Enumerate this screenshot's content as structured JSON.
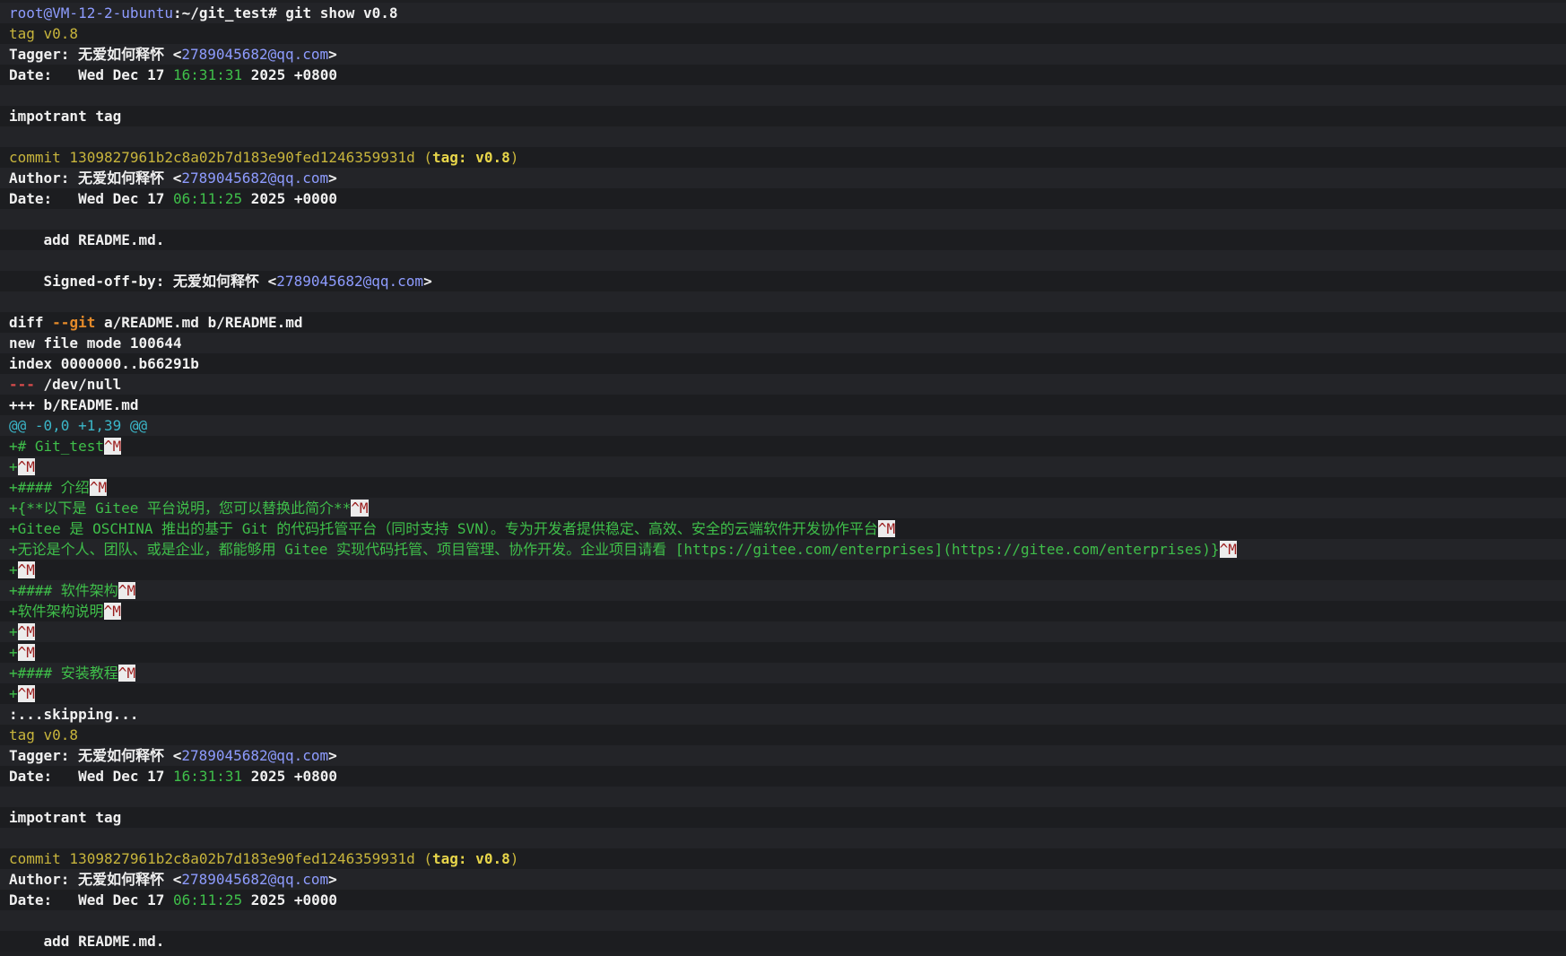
{
  "theme": {
    "background": "#1e1f22",
    "prompt": "#8e9cff",
    "yellow": "#c8b53c",
    "green": "#3fbf4a",
    "cyan": "#3bb7c9",
    "orange": "#e48a2a",
    "red": "#d64b4b",
    "ctrl_char_fg": "#9a1c1c",
    "ctrl_char_bg": "#ececec"
  },
  "lines": [
    [
      {
        "t": "root@VM-12-2-ubuntu",
        "c": "prompt"
      },
      {
        "t": ":~/git_test# git show v0.8",
        "c": "bold"
      }
    ],
    [
      {
        "t": "tag v0.8",
        "c": "yellow"
      }
    ],
    [
      {
        "t": "Tagger: 无爱如何释怀 <",
        "c": "bold"
      },
      {
        "t": "2789045682@qq.com",
        "c": "email"
      },
      {
        "t": ">",
        "c": "bold"
      }
    ],
    [
      {
        "t": "Date:   Wed Dec 17 ",
        "c": "bold"
      },
      {
        "t": "16:31:31",
        "c": "time"
      },
      {
        "t": " 2025 +0800",
        "c": "bold"
      }
    ],
    [],
    [
      {
        "t": "impotrant tag",
        "c": "bold"
      }
    ],
    [],
    [
      {
        "t": "commit 1309827961b2c8a02b7d183e90fed1246359931d (",
        "c": "yellow"
      },
      {
        "t": "tag: v0.8",
        "c": "yellowb"
      },
      {
        "t": ")",
        "c": "yellow"
      }
    ],
    [
      {
        "t": "Author: 无爱如何释怀 <",
        "c": "bold"
      },
      {
        "t": "2789045682@qq.com",
        "c": "email"
      },
      {
        "t": ">",
        "c": "bold"
      }
    ],
    [
      {
        "t": "Date:   Wed Dec 17 ",
        "c": "bold"
      },
      {
        "t": "06:11:25",
        "c": "time"
      },
      {
        "t": " 2025 +0000",
        "c": "bold"
      }
    ],
    [],
    [
      {
        "t": "    add README.md.",
        "c": "bold"
      }
    ],
    [],
    [
      {
        "t": "    Signed-off-by: 无爱如何释怀 <",
        "c": "bold"
      },
      {
        "t": "2789045682@qq.com",
        "c": "email"
      },
      {
        "t": ">",
        "c": "bold"
      }
    ],
    [],
    [
      {
        "t": "diff ",
        "c": "bold"
      },
      {
        "t": "--git",
        "c": "orange"
      },
      {
        "t": " a/README.md b/README.md",
        "c": "bold"
      }
    ],
    [
      {
        "t": "new file mode 100644",
        "c": "bold"
      }
    ],
    [
      {
        "t": "index 0000000..b66291b",
        "c": "bold"
      }
    ],
    [
      {
        "t": "---",
        "c": "red"
      },
      {
        "t": " /dev/null",
        "c": "bold"
      }
    ],
    [
      {
        "t": "+++ b/README.md",
        "c": "bold"
      }
    ],
    [
      {
        "t": "@@ -0,0 +1,39 @@",
        "c": "cyan"
      }
    ],
    [
      {
        "t": "+# Git_test",
        "c": "green"
      },
      {
        "t": "^M",
        "c": "ctrl"
      }
    ],
    [
      {
        "t": "+",
        "c": "green"
      },
      {
        "t": "^M",
        "c": "ctrl"
      }
    ],
    [
      {
        "t": "+#### 介绍",
        "c": "green"
      },
      {
        "t": "^M",
        "c": "ctrl"
      }
    ],
    [
      {
        "t": "+{**以下是 Gitee 平台说明，您可以替换此简介**",
        "c": "green"
      },
      {
        "t": "^M",
        "c": "ctrl"
      }
    ],
    [
      {
        "t": "+Gitee 是 OSCHINA 推出的基于 Git 的代码托管平台（同时支持 SVN）。专为开发者提供稳定、高效、安全的云端软件开发协作平台",
        "c": "green"
      },
      {
        "t": "^M",
        "c": "ctrl"
      }
    ],
    [
      {
        "t": "+无论是个人、团队、或是企业，都能够用 Gitee 实现代码托管、项目管理、协作开发。企业项目请看 [https://gitee.com/enterprises](https://gitee.com/enterprises)}",
        "c": "green"
      },
      {
        "t": "^M",
        "c": "ctrl"
      }
    ],
    [
      {
        "t": "+",
        "c": "green"
      },
      {
        "t": "^M",
        "c": "ctrl"
      }
    ],
    [
      {
        "t": "+#### 软件架构",
        "c": "green"
      },
      {
        "t": "^M",
        "c": "ctrl"
      }
    ],
    [
      {
        "t": "+软件架构说明",
        "c": "green"
      },
      {
        "t": "^M",
        "c": "ctrl"
      }
    ],
    [
      {
        "t": "+",
        "c": "green"
      },
      {
        "t": "^M",
        "c": "ctrl"
      }
    ],
    [
      {
        "t": "+",
        "c": "green"
      },
      {
        "t": "^M",
        "c": "ctrl"
      }
    ],
    [
      {
        "t": "+#### 安装教程",
        "c": "green"
      },
      {
        "t": "^M",
        "c": "ctrl"
      }
    ],
    [
      {
        "t": "+",
        "c": "green"
      },
      {
        "t": "^M",
        "c": "ctrl"
      }
    ],
    [
      {
        "t": ":...skipping...",
        "c": "bold"
      }
    ],
    [
      {
        "t": "tag v0.8",
        "c": "yellow"
      }
    ],
    [
      {
        "t": "Tagger: 无爱如何释怀 <",
        "c": "bold"
      },
      {
        "t": "2789045682@qq.com",
        "c": "email"
      },
      {
        "t": ">",
        "c": "bold"
      }
    ],
    [
      {
        "t": "Date:   Wed Dec 17 ",
        "c": "bold"
      },
      {
        "t": "16:31:31",
        "c": "time"
      },
      {
        "t": " 2025 +0800",
        "c": "bold"
      }
    ],
    [],
    [
      {
        "t": "impotrant tag",
        "c": "bold"
      }
    ],
    [],
    [
      {
        "t": "commit 1309827961b2c8a02b7d183e90fed1246359931d (",
        "c": "yellow"
      },
      {
        "t": "tag: v0.8",
        "c": "yellowb"
      },
      {
        "t": ")",
        "c": "yellow"
      }
    ],
    [
      {
        "t": "Author: 无爱如何释怀 <",
        "c": "bold"
      },
      {
        "t": "2789045682@qq.com",
        "c": "email"
      },
      {
        "t": ">",
        "c": "bold"
      }
    ],
    [
      {
        "t": "Date:   Wed Dec 17 ",
        "c": "bold"
      },
      {
        "t": "06:11:25",
        "c": "time"
      },
      {
        "t": " 2025 +0000",
        "c": "bold"
      }
    ],
    [],
    [
      {
        "t": "    add README.md.",
        "c": "bold"
      }
    ]
  ]
}
